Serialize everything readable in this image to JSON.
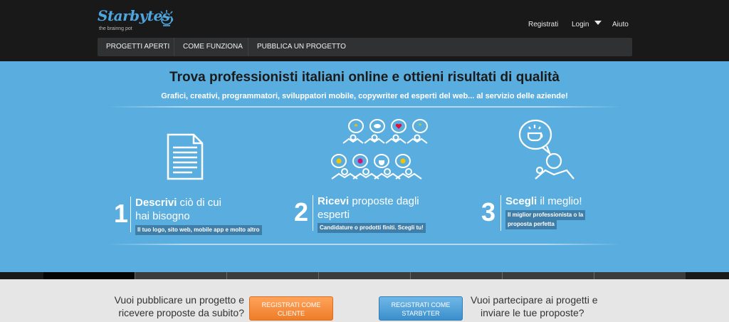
{
  "header": {
    "logo_text": "Starbytes",
    "logo_sub": "the brainng pot",
    "links": {
      "register": "Registrati",
      "login": "Login",
      "help": "Aiuto"
    },
    "nav": [
      "PROGETTI APERTI",
      "COME FUNZIONA",
      "PUBBLICA UN PROGETTO"
    ]
  },
  "hero": {
    "title": "Trova professionisti italiani online e ottieni risultati di qualità",
    "subtitle": "Grafici, creativi, programmatori, sviluppatori mobile, copywriter ed esperti del web... al servizio delle aziende!",
    "steps": [
      {
        "num": "1",
        "title_bold": "Descrivi",
        "title_rest": " ciò di cui",
        "title_line2": "hai bisogno",
        "badge": "Il tuo logo, sito web, mobile app e molto altro"
      },
      {
        "num": "2",
        "title_bold": "Ricevi",
        "title_rest": " proposte dagli",
        "title_line2": "esperti",
        "badge": "Candidature o prodotti finiti. Scegli tu!"
      },
      {
        "num": "3",
        "title_bold": "Scegli",
        "title_rest": " il meglio!",
        "badge_line1": "Il miglior professionista o la",
        "badge_line2": "proposta perfetta"
      }
    ]
  },
  "slider": {
    "segments": 7,
    "active_index": 0
  },
  "cta": {
    "left_line1": "Vuoi pubblicare un progetto e",
    "left_line2": "ricevere proposte da subito?",
    "btn_client_line1": "REGISTRATI COME",
    "btn_client_line2": "CLIENTE",
    "btn_starbyter_line1": "REGISTRATI COME",
    "btn_starbyter_line2": "STARBYTER",
    "right_line1": "Vuoi partecipare ai progetti e",
    "right_line2": "inviare le tue proposte?"
  },
  "colors": {
    "accent": "#5aaedf",
    "header": "#191919",
    "orange": "#ee7d2a",
    "blue": "#3b8fcc"
  },
  "icons": [
    "lightbulb-logo-icon",
    "document-icon",
    "crowd-speech-icon",
    "person-idea-icon",
    "dropdown-caret-icon"
  ]
}
